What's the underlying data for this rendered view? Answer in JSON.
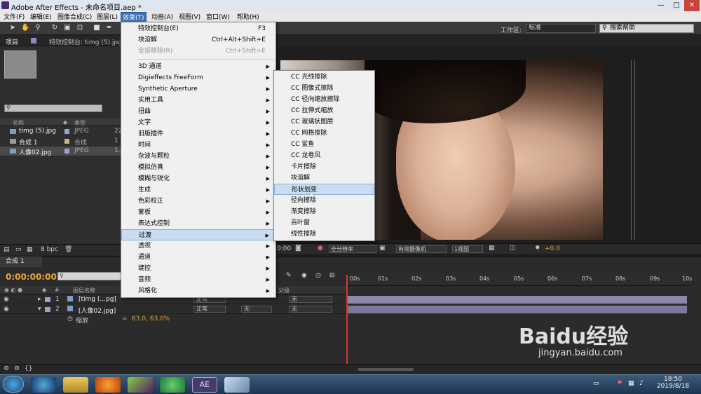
{
  "window": {
    "title": "Adobe After Effects - 未命名项目.aep *",
    "controls": [
      "—",
      "□",
      "✕"
    ]
  },
  "menubar": {
    "items": [
      "文件(F)",
      "编辑(E)",
      "图像合成(C)",
      "图层(L)",
      "效果(T)",
      "动画(A)",
      "视图(V)",
      "窗口(W)",
      "帮助(H)"
    ]
  },
  "toolbar": {
    "workspace_label": "工作区:",
    "workspace_value": "标准",
    "help_search_placeholder": "搜索帮助"
  },
  "project_panel": {
    "tabs": [
      "项目",
      "特效控制台: timg (5).jpg"
    ],
    "columns": [
      "名称",
      "类型"
    ],
    "items": [
      {
        "name": "timg (5).jpg",
        "type": "JPEG",
        "size": "22"
      },
      {
        "name": "合成 1",
        "type": "合成",
        "size": "1"
      },
      {
        "name": "人像02.jpg",
        "type": "JPEG",
        "size": "1.3"
      }
    ],
    "bpc": "8 bpc"
  },
  "viewer": {
    "timecode": "0:00",
    "resolution": "全分辨率",
    "camera": "有效摄像机",
    "views": "1视图",
    "exposure": "+0.0"
  },
  "timeline": {
    "tab": "合成 1",
    "timecode": "0:00:00:00",
    "col_source": "图层名称",
    "col_parent": "父级",
    "ruler": [
      "00s",
      "01s",
      "02s",
      "03s",
      "04s",
      "05s",
      "06s",
      "07s",
      "08s",
      "09s",
      "10s"
    ],
    "layers": [
      {
        "num": "1",
        "name": "[timg (...pg]",
        "mode": "正常",
        "parent": "无"
      },
      {
        "num": "2",
        "name": "[人像02.jpg]",
        "mode": "正常",
        "trkmat": "无",
        "parent": "无"
      }
    ],
    "property_name": "缩放",
    "property_value": "63.0, 63.0%"
  },
  "effects_menu": {
    "top": [
      {
        "label": "特效控制台(E)",
        "shortcut": "F3"
      },
      {
        "label": "块溶解",
        "shortcut": "Ctrl+Alt+Shift+E"
      },
      {
        "label": "全部移除(R)",
        "shortcut": "Ctrl+Shift+E"
      }
    ],
    "categories": [
      "3D 通道",
      "Digieffects FreeForm",
      "Synthetic Aperture",
      "实用工具",
      "扭曲",
      "文字",
      "旧版插件",
      "时间",
      "杂波与颗粒",
      "模拟仿真",
      "模糊与锐化",
      "生成",
      "色彩校正",
      "蒙板",
      "表达式控制",
      "过渡",
      "透视",
      "通道",
      "键控",
      "音频",
      "风格化"
    ]
  },
  "transition_submenu": {
    "items": [
      "CC 光线擦除",
      "CC 图像式擦除",
      "CC 径向缩放擦除",
      "CC 拉伸式缩放",
      "CC 玻璃状图层",
      "CC 网格擦除",
      "CC 鲨鱼",
      "CC 龙卷风",
      "卡片擦除",
      "块溶解",
      "形状划变",
      "径向擦除",
      "渐变擦除",
      "百叶窗",
      "线性擦除"
    ]
  },
  "taskbar": {
    "time": "18:50",
    "date": "2019/8/18",
    "active_app": "AE"
  },
  "watermark": {
    "brand": "Baidu经验",
    "url": "jingyan.baidu.com"
  },
  "colors": {
    "menu_highlight": "#c8dcf2",
    "timecode": "#e8a53a",
    "cti": "#d8362e"
  }
}
